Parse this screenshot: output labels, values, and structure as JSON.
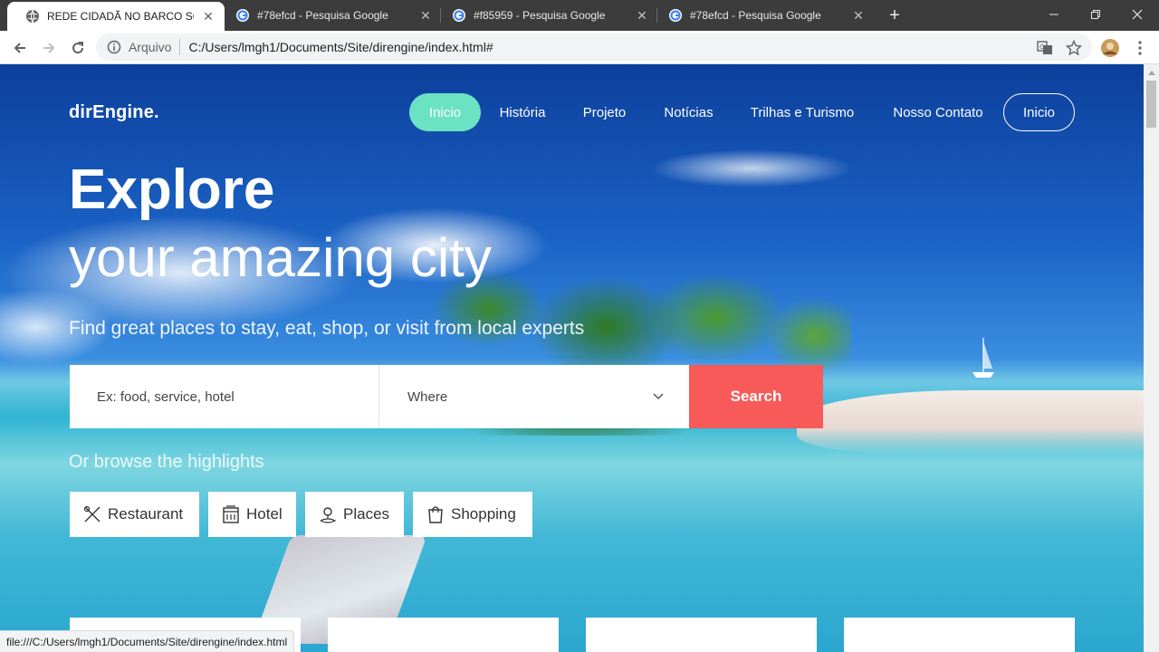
{
  "browser": {
    "tabs": [
      {
        "title": "REDE CIDADÃ NO BARCO SOLIDÁ",
        "favicon": "globe-icon",
        "active": true
      },
      {
        "title": "#78efcd - Pesquisa Google",
        "favicon": "google-icon",
        "active": false
      },
      {
        "title": "#f85959 - Pesquisa Google",
        "favicon": "google-icon",
        "active": false
      },
      {
        "title": "#78efcd - Pesquisa Google",
        "favicon": "google-icon",
        "active": false
      }
    ],
    "omnibox": {
      "scheme_label": "Arquivo",
      "url": "C:/Users/lmgh1/Documents/Site/direngine/index.html#"
    },
    "status_bar": "file:///C:/Users/lmgh1/Documents/Site/direngine/index.html"
  },
  "site": {
    "brand": "dirEngine.",
    "nav": [
      {
        "label": "Inicio",
        "style": "pill"
      },
      {
        "label": "História",
        "style": "plain"
      },
      {
        "label": "Projeto",
        "style": "plain"
      },
      {
        "label": "Notícias",
        "style": "plain"
      },
      {
        "label": "Trilhas e Turismo",
        "style": "plain"
      },
      {
        "label": "Nosso Contato",
        "style": "plain"
      },
      {
        "label": "Inicio",
        "style": "outline"
      }
    ],
    "hero": {
      "title_bold": "Explore",
      "title_light": "your amazing city",
      "subtitle": "Find great places to stay, eat, shop, or visit from local experts"
    },
    "search": {
      "what_placeholder": "Ex: food, service, hotel",
      "where_value": "Where",
      "button_label": "Search"
    },
    "browse_label": "Or browse the highlights",
    "categories": [
      {
        "label": "Restaurant",
        "icon": "utensils-icon"
      },
      {
        "label": "Hotel",
        "icon": "hotel-icon"
      },
      {
        "label": "Places",
        "icon": "map-pin-icon"
      },
      {
        "label": "Shopping",
        "icon": "shopping-bag-icon"
      }
    ]
  },
  "colors": {
    "accent_green": "#6be3c2",
    "accent_red": "#f85959",
    "tab_strip": "#3c3c3c"
  }
}
